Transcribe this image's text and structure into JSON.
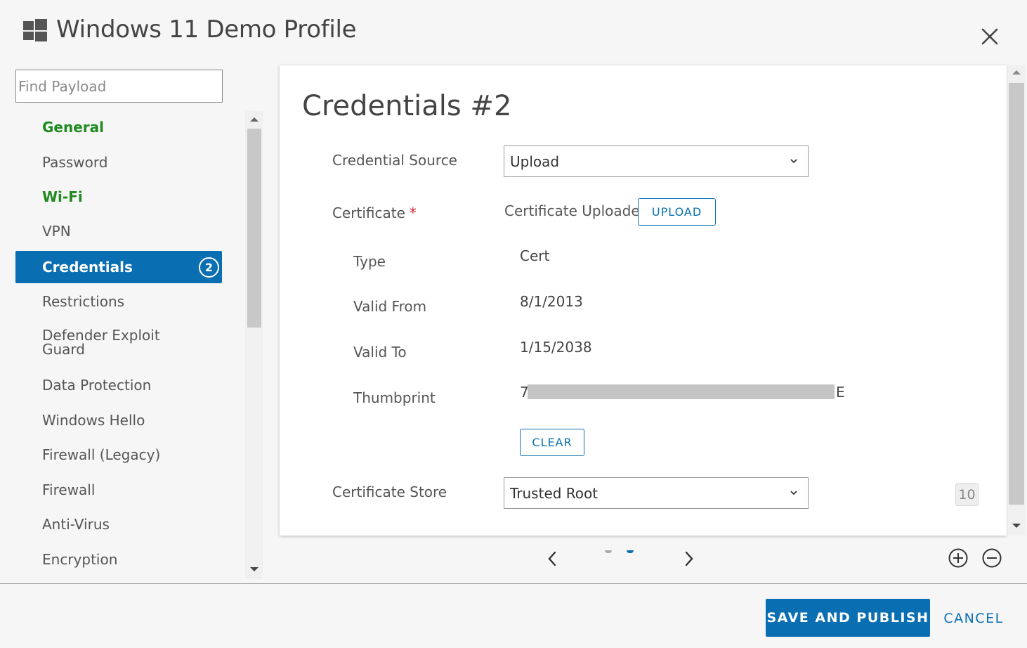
{
  "window": {
    "title": "Windows 11 Demo Profile",
    "logo_icon": "windows-logo-icon",
    "close_icon": "close-icon"
  },
  "search": {
    "placeholder": "Find Payload",
    "value": ""
  },
  "sidebar": {
    "items": [
      {
        "label": "General",
        "state": "configured"
      },
      {
        "label": "Password",
        "state": "default"
      },
      {
        "label": "Wi-Fi",
        "state": "configured"
      },
      {
        "label": "VPN",
        "state": "default"
      },
      {
        "label": "Credentials",
        "state": "active",
        "badge": "2"
      },
      {
        "label": "Restrictions",
        "state": "default"
      },
      {
        "label": "Defender Exploit Guard",
        "state": "default"
      },
      {
        "label": "Data Protection",
        "state": "default"
      },
      {
        "label": "Windows Hello",
        "state": "default"
      },
      {
        "label": "Firewall (Legacy)",
        "state": "default"
      },
      {
        "label": "Firewall",
        "state": "default"
      },
      {
        "label": "Anti-Virus",
        "state": "default"
      },
      {
        "label": "Encryption",
        "state": "default"
      }
    ]
  },
  "card": {
    "title": "Credentials #2",
    "credential_source": {
      "label": "Credential Source",
      "value": "Upload"
    },
    "certificate": {
      "label": "Certificate",
      "required_mark": "*",
      "status": "Certificate Uploaded",
      "upload_label": "UPLOAD"
    },
    "type": {
      "label": "Type",
      "value": "Cert"
    },
    "valid_from": {
      "label": "Valid From",
      "value": "8/1/2013"
    },
    "valid_to": {
      "label": "Valid To",
      "value": "1/15/2038"
    },
    "thumbprint": {
      "label": "Thumbprint",
      "value_start": "7",
      "value_end": "E"
    },
    "clear_label": "CLEAR",
    "certificate_store": {
      "label": "Certificate Store",
      "value": "Trusted Root"
    },
    "counter": "10"
  },
  "pager": {
    "prev_icon": "chevron-left-icon",
    "next_icon": "chevron-right-icon",
    "add_icon": "plus-circle-icon",
    "remove_icon": "minus-circle-icon"
  },
  "footer": {
    "save_label": "SAVE AND PUBLISH",
    "cancel_label": "CANCEL"
  },
  "colors": {
    "accent": "#0a6fb2",
    "configured": "#1f8a1f",
    "required": "#d9202c"
  }
}
